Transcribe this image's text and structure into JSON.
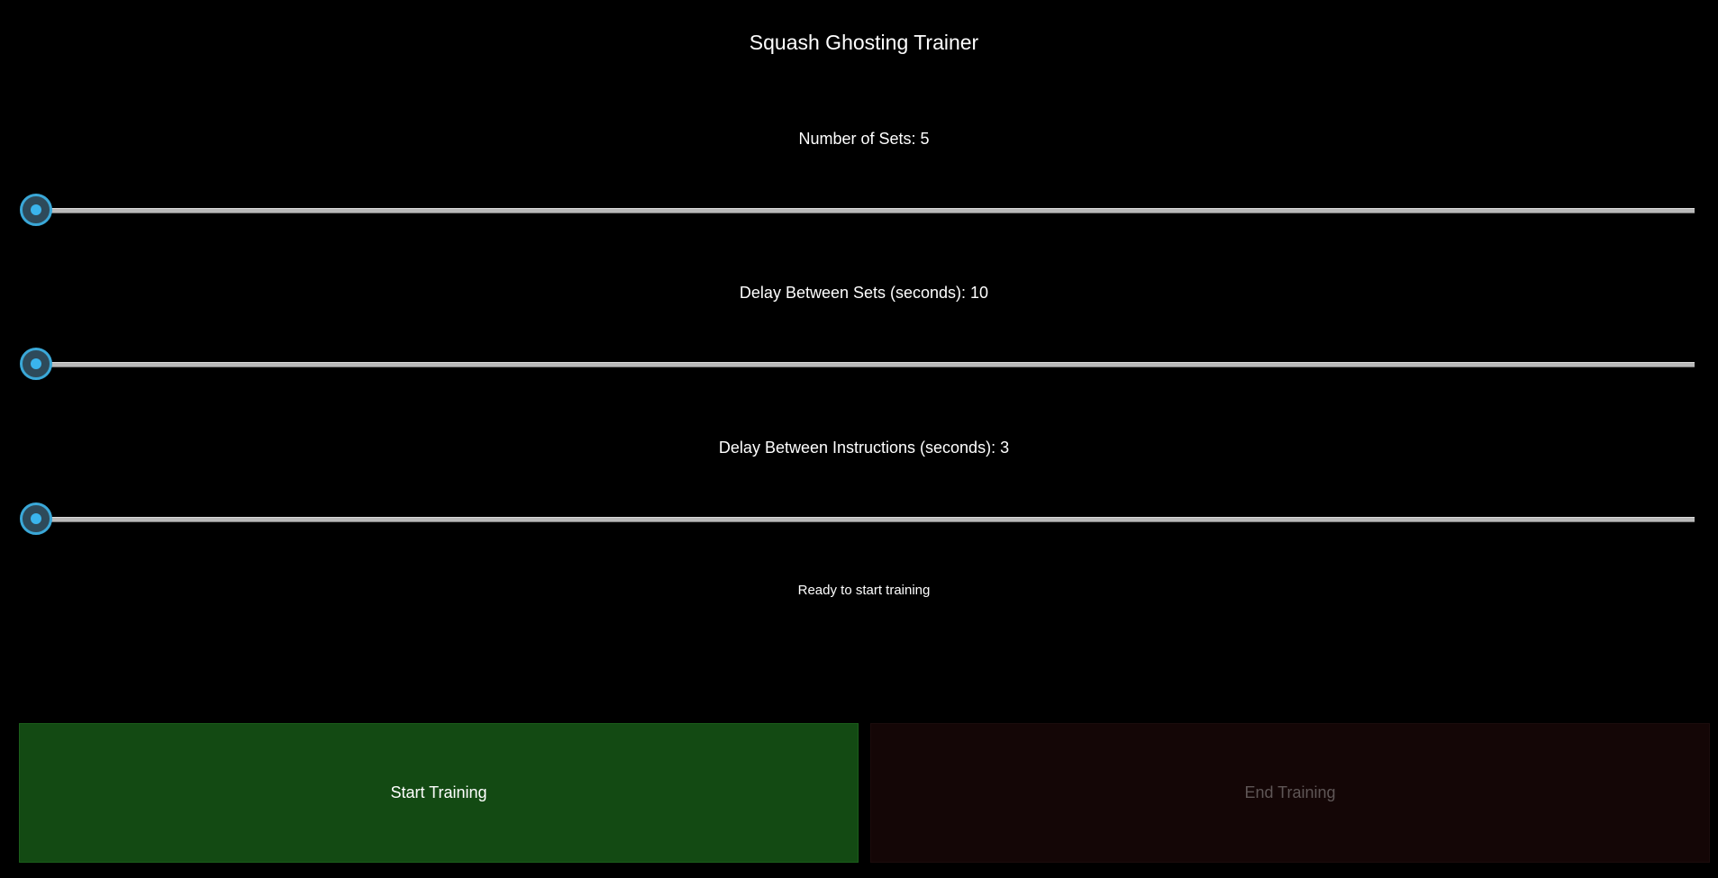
{
  "app": {
    "title": "Squash Ghosting Trainer"
  },
  "sliders": [
    {
      "label": "Number of Sets: 5",
      "value": 5,
      "fraction": 0.0
    },
    {
      "label": "Delay Between Sets (seconds): 10",
      "value": 10,
      "fraction": 0.0
    },
    {
      "label": "Delay Between Instructions (seconds): 3",
      "value": 3,
      "fraction": 0.0
    }
  ],
  "status": {
    "text": "Ready to start training"
  },
  "buttons": {
    "start_label": "Start Training",
    "end_label": "End Training",
    "end_enabled": false
  },
  "colors": {
    "background": "#000000",
    "start_button": "#134a13",
    "end_button_disabled": "#140606",
    "slider_accent": "#3aa8d8",
    "slider_track": "#b9b9b9"
  }
}
